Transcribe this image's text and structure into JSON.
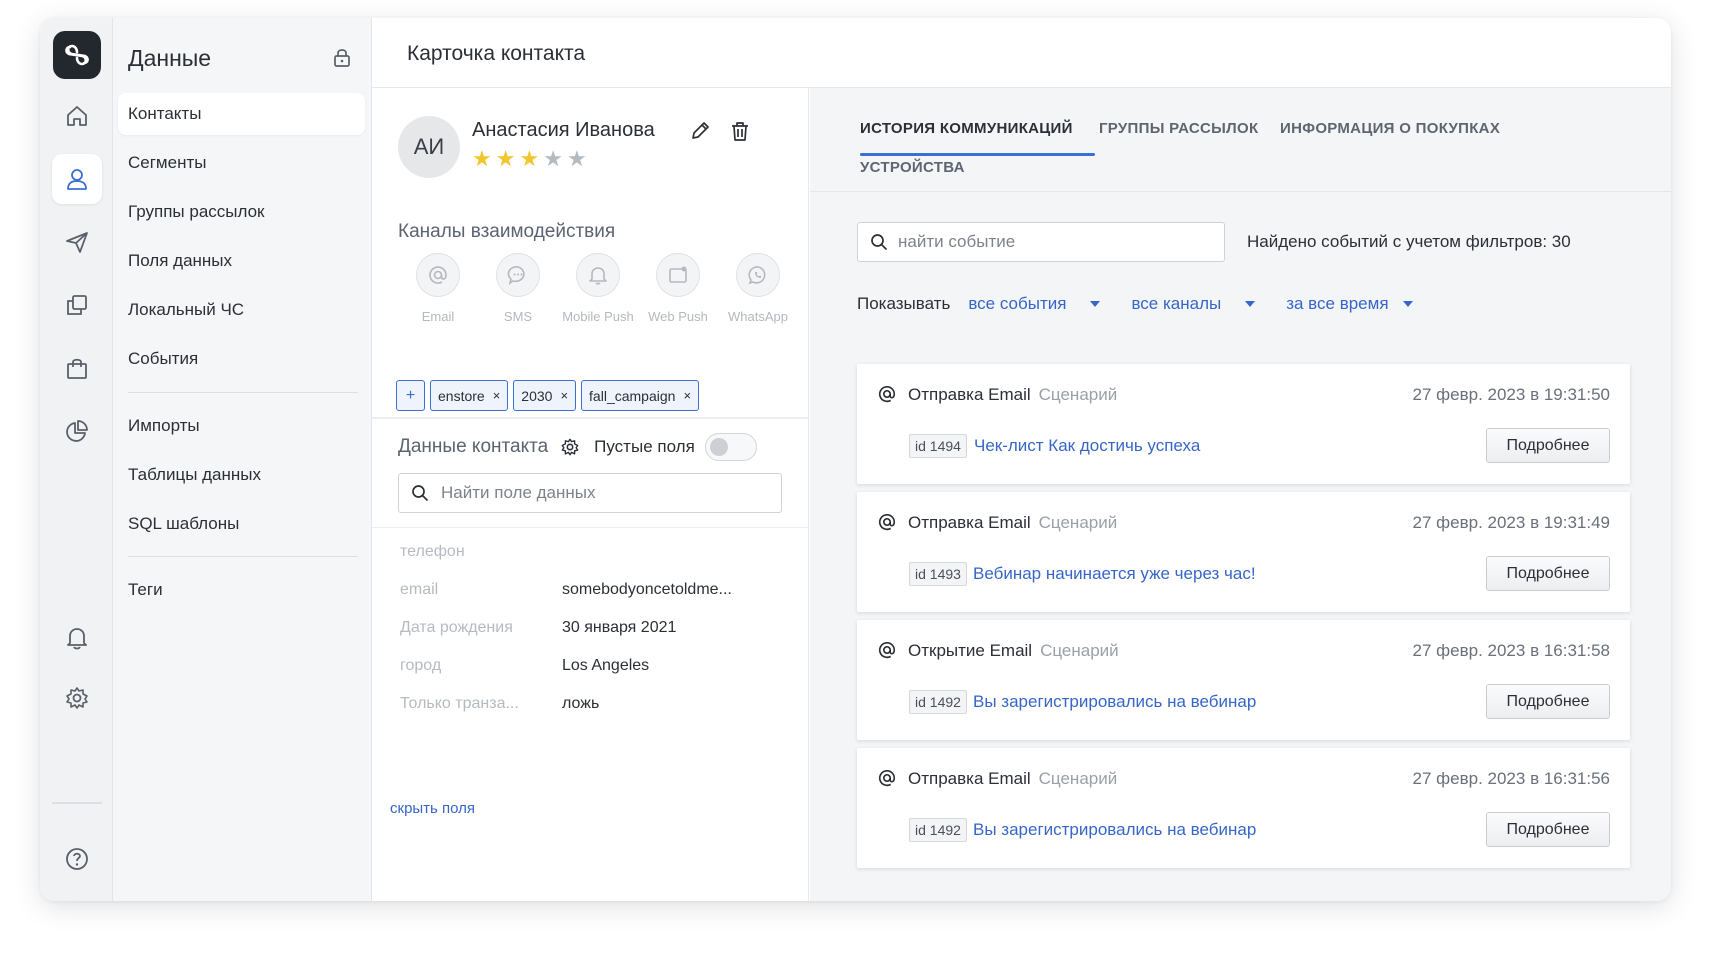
{
  "nav": {
    "title": "Данные",
    "items": [
      {
        "label": "Контакты"
      },
      {
        "label": "Сегменты"
      },
      {
        "label": "Группы рассылок"
      },
      {
        "label": "Поля данных"
      },
      {
        "label": "Локальный ЧС"
      },
      {
        "label": "События"
      },
      {
        "label": "Импорты"
      },
      {
        "label": "Таблицы данных"
      },
      {
        "label": "SQL шаблоны"
      },
      {
        "label": "Теги"
      }
    ]
  },
  "rail": {
    "icons": [
      "home-icon",
      "contacts-icon",
      "send-icon",
      "copy-icon",
      "shopping-bag-icon",
      "pie-chart-icon",
      "bell-icon",
      "gear-icon",
      "help-icon"
    ]
  },
  "header": {
    "title": "Карточка контакта"
  },
  "contact": {
    "initials": "АИ",
    "name": "Анастасия Иванова",
    "rating": 3,
    "rating_max": 5,
    "channels_title": "Каналы взаимодействия",
    "channels": [
      {
        "label": "Email",
        "icon": "at-icon"
      },
      {
        "label": "SMS",
        "icon": "chat-icon"
      },
      {
        "label": "Mobile Push",
        "icon": "bell-icon"
      },
      {
        "label": "Web Push",
        "icon": "browser-icon"
      },
      {
        "label": "WhatsApp",
        "icon": "whatsapp-icon"
      }
    ],
    "tag_add": "+",
    "tags": [
      {
        "label": "enstore",
        "remove": "×"
      },
      {
        "label": "2030",
        "remove": "×"
      },
      {
        "label": "fall_campaign",
        "remove": "×"
      }
    ],
    "data_title": "Данные контакта",
    "empty_fields_label": "Пустые поля",
    "empty_fields_on": false,
    "field_search_placeholder": "Найти поле данных",
    "fields": [
      {
        "key": "телефон",
        "value": ""
      },
      {
        "key": "email",
        "value": "somebodyoncetoldme..."
      },
      {
        "key": "Дата рождения",
        "value": "30 января 2021"
      },
      {
        "key": "город",
        "value": "Los Angeles"
      },
      {
        "key": "Только транза...",
        "value": "ложь"
      }
    ],
    "hide_fields_link": "скрыть поля"
  },
  "tabs": [
    {
      "label": "ИСТОРИЯ КОММУНИКАЦИЙ",
      "active": true
    },
    {
      "label": "ГРУППЫ РАССЫЛОК",
      "active": false
    },
    {
      "label": "ИНФОРМАЦИЯ О ПОКУПКАХ",
      "active": false
    },
    {
      "label": "УСТРОЙСТВА",
      "active": false
    }
  ],
  "events": {
    "search_placeholder": "найти событие",
    "found_text": "Найдено событий с учетом фильтров: 30",
    "show_label": "Показывать",
    "filters": [
      "все события",
      "все каналы",
      "за все время"
    ],
    "items": [
      {
        "type": "Отправка Email",
        "source": "Сценарий",
        "date": "27 февр. 2023 в 19:31:50",
        "id": "id 1494",
        "title": "Чек-лист Как достичь успеха",
        "button": "Подробнее"
      },
      {
        "type": "Отправка Email",
        "source": "Сценарий",
        "date": "27 февр. 2023 в 19:31:49",
        "id": "id 1493",
        "title": "Вебинар начинается уже через час!",
        "button": "Подробнее"
      },
      {
        "type": "Открытие Email",
        "source": "Сценарий",
        "date": "27 февр. 2023 в 16:31:58",
        "id": "id 1492",
        "title": "Вы зарегистрировались на вебинар",
        "button": "Подробнее"
      },
      {
        "type": "Отправка Email",
        "source": "Сценарий",
        "date": "27 февр. 2023 в 16:31:56",
        "id": "id 1492",
        "title": "Вы зарегистрировались на вебинар",
        "button": "Подробнее"
      }
    ]
  },
  "colors": {
    "accent": "#3b6fd4",
    "link": "#3766c8",
    "star_on": "#f1c62e",
    "star_off": "#b5b9c0"
  }
}
